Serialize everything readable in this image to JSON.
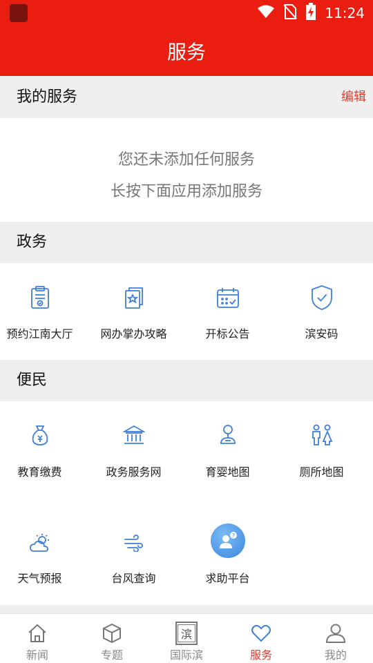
{
  "status_bar": {
    "time": "11:24"
  },
  "header": {
    "title": "服务"
  },
  "my_services": {
    "title": "我的服务",
    "edit_label": "编辑",
    "empty_line1": "您还未添加任何服务",
    "empty_line2": "长按下面应用添加服务"
  },
  "government": {
    "title": "政务",
    "items": [
      {
        "label": "预约江南大厅",
        "icon": "clipboard-icon"
      },
      {
        "label": "网办掌办攻略",
        "icon": "star-document-icon"
      },
      {
        "label": "开标公告",
        "icon": "calendar-icon"
      },
      {
        "label": "滨安码",
        "icon": "shield-check-icon"
      }
    ]
  },
  "convenience": {
    "title": "便民",
    "items": [
      {
        "label": "教育缴费",
        "icon": "money-bag-icon"
      },
      {
        "label": "政务服务网",
        "icon": "government-building-icon"
      },
      {
        "label": "育婴地图",
        "icon": "baby-person-icon"
      },
      {
        "label": "厕所地图",
        "icon": "restroom-icon"
      },
      {
        "label": "天气预报",
        "icon": "weather-icon"
      },
      {
        "label": "台风查询",
        "icon": "wind-icon"
      },
      {
        "label": "求助平台",
        "icon": "help-person-icon"
      }
    ]
  },
  "bottom_nav": {
    "items": [
      {
        "label": "新闻",
        "icon": "home-icon",
        "active": false
      },
      {
        "label": "专题",
        "icon": "cube-icon",
        "active": false
      },
      {
        "label": "国际滨",
        "icon": "logo-icon",
        "logo_text": "滨",
        "active": false
      },
      {
        "label": "服务",
        "icon": "heart-icon",
        "active": true
      },
      {
        "label": "我的",
        "icon": "user-icon",
        "active": false
      }
    ]
  },
  "colors": {
    "brand_red": "#ea1e10",
    "accent_red": "#e53a2b",
    "icon_blue": "#3d7fd9",
    "nav_gray": "#888888"
  }
}
